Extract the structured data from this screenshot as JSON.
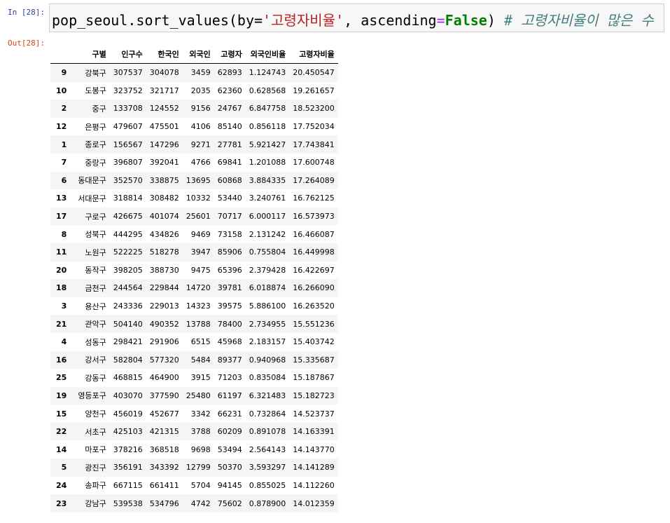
{
  "input_prompt": "In [28]:",
  "output_prompt": "Out[28]:",
  "code": {
    "pre": "pop_seoul.sort_values(by=",
    "arg_str": "'고령자비율'",
    "mid": ", ascending",
    "eq": "=",
    "kw": "False",
    "post": ") ",
    "comment": "# 고령자비율이 많은 수"
  },
  "table": {
    "columns": [
      "구별",
      "인구수",
      "한국인",
      "외국인",
      "고령자",
      "외국인비율",
      "고령자비율"
    ],
    "rows": [
      {
        "index": "9",
        "cells": [
          "강북구",
          "307537",
          "304078",
          "3459",
          "62893",
          "1.124743",
          "20.450547"
        ]
      },
      {
        "index": "10",
        "cells": [
          "도봉구",
          "323752",
          "321717",
          "2035",
          "62360",
          "0.628568",
          "19.261657"
        ]
      },
      {
        "index": "2",
        "cells": [
          "중구",
          "133708",
          "124552",
          "9156",
          "24767",
          "6.847758",
          "18.523200"
        ]
      },
      {
        "index": "12",
        "cells": [
          "은평구",
          "479607",
          "475501",
          "4106",
          "85140",
          "0.856118",
          "17.752034"
        ]
      },
      {
        "index": "1",
        "cells": [
          "종로구",
          "156567",
          "147296",
          "9271",
          "27781",
          "5.921427",
          "17.743841"
        ]
      },
      {
        "index": "7",
        "cells": [
          "중랑구",
          "396807",
          "392041",
          "4766",
          "69841",
          "1.201088",
          "17.600748"
        ]
      },
      {
        "index": "6",
        "cells": [
          "동대문구",
          "352570",
          "338875",
          "13695",
          "60868",
          "3.884335",
          "17.264089"
        ]
      },
      {
        "index": "13",
        "cells": [
          "서대문구",
          "318814",
          "308482",
          "10332",
          "53440",
          "3.240761",
          "16.762125"
        ]
      },
      {
        "index": "17",
        "cells": [
          "구로구",
          "426675",
          "401074",
          "25601",
          "70717",
          "6.000117",
          "16.573973"
        ]
      },
      {
        "index": "8",
        "cells": [
          "성북구",
          "444295",
          "434826",
          "9469",
          "73158",
          "2.131242",
          "16.466087"
        ]
      },
      {
        "index": "11",
        "cells": [
          "노원구",
          "522225",
          "518278",
          "3947",
          "85906",
          "0.755804",
          "16.449998"
        ]
      },
      {
        "index": "20",
        "cells": [
          "동작구",
          "398205",
          "388730",
          "9475",
          "65396",
          "2.379428",
          "16.422697"
        ]
      },
      {
        "index": "18",
        "cells": [
          "금천구",
          "244564",
          "229844",
          "14720",
          "39781",
          "6.018874",
          "16.266090"
        ]
      },
      {
        "index": "3",
        "cells": [
          "용산구",
          "243336",
          "229013",
          "14323",
          "39575",
          "5.886100",
          "16.263520"
        ]
      },
      {
        "index": "21",
        "cells": [
          "관악구",
          "504140",
          "490352",
          "13788",
          "78400",
          "2.734955",
          "15.551236"
        ]
      },
      {
        "index": "4",
        "cells": [
          "성동구",
          "298421",
          "291906",
          "6515",
          "45968",
          "2.183157",
          "15.403742"
        ]
      },
      {
        "index": "16",
        "cells": [
          "강서구",
          "582804",
          "577320",
          "5484",
          "89377",
          "0.940968",
          "15.335687"
        ]
      },
      {
        "index": "25",
        "cells": [
          "강동구",
          "468815",
          "464900",
          "3915",
          "71203",
          "0.835084",
          "15.187867"
        ]
      },
      {
        "index": "19",
        "cells": [
          "영등포구",
          "403070",
          "377590",
          "25480",
          "61197",
          "6.321483",
          "15.182723"
        ]
      },
      {
        "index": "15",
        "cells": [
          "양천구",
          "456019",
          "452677",
          "3342",
          "66231",
          "0.732864",
          "14.523737"
        ]
      },
      {
        "index": "22",
        "cells": [
          "서초구",
          "425103",
          "421315",
          "3788",
          "60209",
          "0.891078",
          "14.163391"
        ]
      },
      {
        "index": "14",
        "cells": [
          "마포구",
          "378216",
          "368518",
          "9698",
          "53494",
          "2.564143",
          "14.143770"
        ]
      },
      {
        "index": "5",
        "cells": [
          "광진구",
          "356191",
          "343392",
          "12799",
          "50370",
          "3.593297",
          "14.141289"
        ]
      },
      {
        "index": "24",
        "cells": [
          "송파구",
          "667115",
          "661411",
          "5704",
          "94145",
          "0.855025",
          "14.112260"
        ]
      },
      {
        "index": "23",
        "cells": [
          "강남구",
          "539538",
          "534796",
          "4742",
          "75602",
          "0.878900",
          "14.012359"
        ]
      }
    ]
  }
}
